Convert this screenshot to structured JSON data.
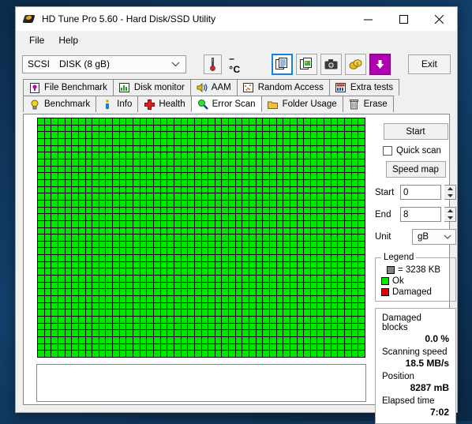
{
  "window": {
    "title": "HD Tune Pro 5.60 - Hard Disk/SSD Utility",
    "icon": "harddisk-icon",
    "minimize_label": "—",
    "maximize_label": "□",
    "close_label": "✕"
  },
  "menu": {
    "items": [
      {
        "label": "File",
        "mnemonic": "F"
      },
      {
        "label": "Help",
        "mnemonic": "H"
      }
    ]
  },
  "toolbar": {
    "drive": {
      "bus": "SCSI",
      "name": "DISK (8 gB)",
      "value": "SCSI   DISK (8 gB)"
    },
    "temperature": {
      "icon": "thermometer-icon",
      "value": "– °C"
    },
    "icons": [
      {
        "name": "copy-text-icon",
        "selected": true
      },
      {
        "name": "copy-image-icon",
        "selected": false
      },
      {
        "name": "screenshot-camera-icon",
        "selected": false
      },
      {
        "name": "coins-icon",
        "selected": false
      },
      {
        "name": "download-arrow-icon",
        "selected": false
      }
    ],
    "exit_label": "Exit"
  },
  "tabs": {
    "row1": [
      {
        "label": "File Benchmark",
        "icon": "file-benchmark-icon",
        "active": false
      },
      {
        "label": "Disk monitor",
        "icon": "disk-monitor-icon",
        "active": false
      },
      {
        "label": "AAM",
        "icon": "speaker-icon",
        "active": false
      },
      {
        "label": "Random Access",
        "icon": "random-access-icon",
        "active": false
      },
      {
        "label": "Extra tests",
        "icon": "extra-tests-icon",
        "active": false
      }
    ],
    "row2": [
      {
        "label": "Benchmark",
        "icon": "lightbulb-icon",
        "active": false
      },
      {
        "label": "Info",
        "icon": "info-icon",
        "active": false
      },
      {
        "label": "Health",
        "icon": "health-cross-icon",
        "active": false
      },
      {
        "label": "Error Scan",
        "icon": "magnifier-icon",
        "active": true
      },
      {
        "label": "Folder Usage",
        "icon": "folder-icon",
        "active": false
      },
      {
        "label": "Erase",
        "icon": "trash-icon",
        "active": false
      }
    ]
  },
  "scan": {
    "grid": {
      "columns": 48,
      "rows": 35,
      "ok_color": "#00e800",
      "damaged_color": "#e00000",
      "background_color": "#000000",
      "total_blocks": 1680,
      "damaged_blocks": 0
    },
    "log_text": ""
  },
  "controls": {
    "start_label": "Start",
    "quick_scan_label": "Quick scan",
    "quick_scan_checked": false,
    "speed_map_label": "Speed map",
    "start_field": {
      "label": "Start",
      "value": "0"
    },
    "end_field": {
      "label": "End",
      "value": "8"
    },
    "unit_field": {
      "label": "Unit",
      "value": "gB"
    }
  },
  "legend": {
    "title": "Legend",
    "block_size": "= 3238 KB",
    "ok_label": "Ok",
    "damaged_label": "Damaged"
  },
  "stats": [
    {
      "label": "Damaged blocks",
      "value": "0.0 %"
    },
    {
      "label": "Scanning speed",
      "value": "18.5 MB/s"
    },
    {
      "label": "Position",
      "value": "8287 mB"
    },
    {
      "label": "Elapsed time",
      "value": "7:02"
    }
  ],
  "colors": {
    "accent": "#1880d8",
    "ok": "#00e800",
    "damaged": "#e00000",
    "window_bg": "#f0f0f0",
    "desktop": "#10375c"
  }
}
